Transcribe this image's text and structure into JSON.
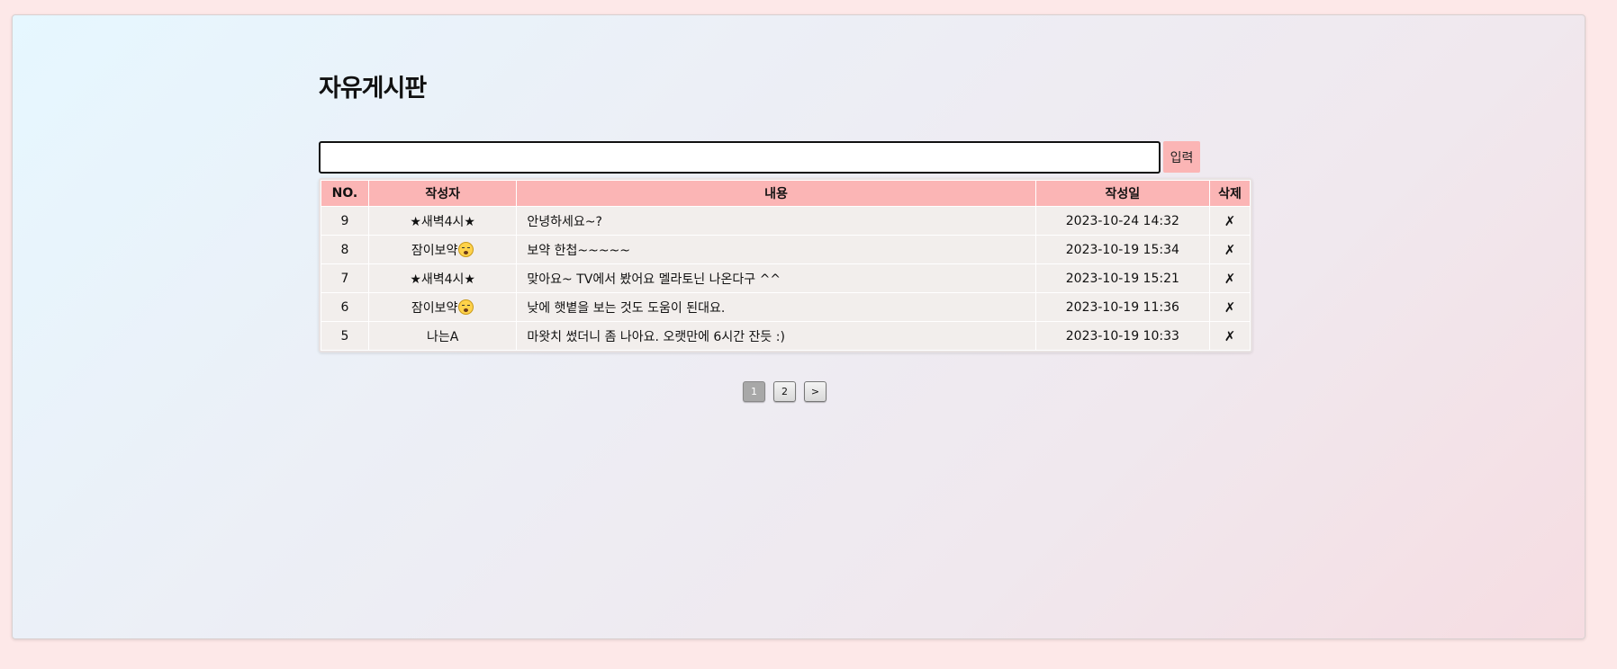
{
  "page": {
    "title": "자유게시판"
  },
  "form": {
    "input_value": "",
    "submit_label": "입력"
  },
  "table": {
    "headers": {
      "no": "NO.",
      "author": "작성자",
      "content": "내용",
      "date": "작성일",
      "delete": "삭제"
    },
    "rows": [
      {
        "no": "9",
        "author": "★새벽4시★",
        "author_emoji": false,
        "content": "안녕하세요~?",
        "date": "2023-10-24 14:32",
        "delete": "✗"
      },
      {
        "no": "8",
        "author": "잠이보약",
        "author_emoji": true,
        "content": "보약 한첩~~~~~",
        "date": "2023-10-19 15:34",
        "delete": "✗"
      },
      {
        "no": "7",
        "author": "★새벽4시★",
        "author_emoji": false,
        "content": "맞아요~ TV에서 봤어요 멜라토닌 나온다구 ^^",
        "date": "2023-10-19 15:21",
        "delete": "✗"
      },
      {
        "no": "6",
        "author": "잠이보약",
        "author_emoji": true,
        "content": "낮에 햇볕을 보는 것도 도움이 된대요.",
        "date": "2023-10-19 11:36",
        "delete": "✗"
      },
      {
        "no": "5",
        "author": "나는A",
        "author_emoji": false,
        "content": "마왓치 썼더니 좀 나아요. 오랫만에 6시간 잔듯 :)",
        "date": "2023-10-19 10:33",
        "delete": "✗"
      }
    ]
  },
  "pagination": {
    "pages": [
      "1",
      "2"
    ],
    "next_label": ">",
    "current": "1"
  },
  "emoji": {
    "author_emoji_icon": "sleeping-face-icon"
  }
}
